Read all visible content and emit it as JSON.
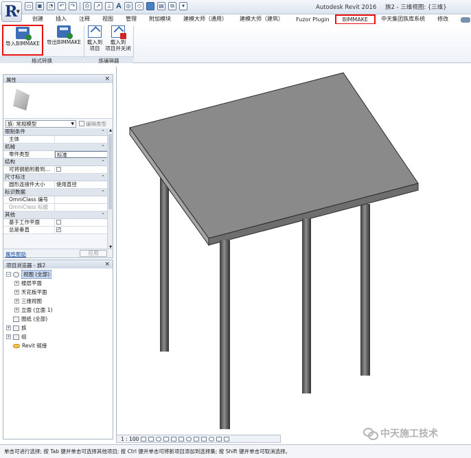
{
  "app": {
    "logo_letter": "R",
    "title": "Autodesk Revit 2016",
    "document": "族2 - 三维视图: {三维}"
  },
  "ribbon": {
    "tabs": [
      {
        "label": "创建"
      },
      {
        "label": "插入"
      },
      {
        "label": "注释"
      },
      {
        "label": "视图"
      },
      {
        "label": "管理"
      },
      {
        "label": "附加模块"
      },
      {
        "label": "建模大师（通用）"
      },
      {
        "label": "建模大师（建筑）"
      },
      {
        "label": "Fuzor Plugin"
      },
      {
        "label": "BIMMAKE"
      },
      {
        "label": "中天集团族库系统"
      },
      {
        "label": "修改"
      }
    ],
    "active_tab": "BIMMAKE",
    "buttons": {
      "import": "导入BIMMAKE",
      "export": "导出BIMMAKE",
      "load_to_project": "载入到\n项目",
      "load_close": "载入到\n项目并关闭"
    },
    "panels": {
      "format": "格式转换",
      "family_editor": "族编辑器"
    }
  },
  "properties": {
    "title": "属性",
    "type_name": "族: 常规模型",
    "edit_type": "编辑类型",
    "groups": [
      {
        "name": "限制条件",
        "rows": [
          {
            "k": "主体",
            "v": ""
          }
        ]
      },
      {
        "name": "机械",
        "rows": [
          {
            "k": "零件类型",
            "v": "标准"
          }
        ]
      },
      {
        "name": "结构",
        "rows": [
          {
            "k": "可将钢筋附着到...",
            "v": "",
            "check": false
          }
        ]
      },
      {
        "name": "尺寸标注",
        "rows": [
          {
            "k": "圆形连接件大小",
            "v": "使用直径"
          }
        ]
      },
      {
        "name": "标识数据",
        "rows": [
          {
            "k": "OmniClass 编号",
            "v": ""
          },
          {
            "k": "OmniClass 标题",
            "v": "",
            "dim": true
          }
        ]
      },
      {
        "name": "其他",
        "rows": [
          {
            "k": "基于工作平面",
            "v": "",
            "check": false
          },
          {
            "k": "总是垂直",
            "v": "",
            "check": true
          }
        ]
      }
    ],
    "help": "属性帮助",
    "apply": "应用"
  },
  "browser": {
    "title": "项目浏览器 - 族2",
    "items": [
      {
        "label": "视图 (全部)",
        "level": 0,
        "toggle": "-",
        "icon": "view"
      },
      {
        "label": "楼层平面",
        "level": 1,
        "toggle": "+"
      },
      {
        "label": "天花板平面",
        "level": 1,
        "toggle": "+"
      },
      {
        "label": "三维视图",
        "level": 1,
        "toggle": "+"
      },
      {
        "label": "立面 (立面 1)",
        "level": 1,
        "toggle": "+"
      },
      {
        "label": "图纸 (全部)",
        "level": 0,
        "toggle": "",
        "icon": "sheet"
      },
      {
        "label": "族",
        "level": 0,
        "toggle": "+",
        "icon": "family"
      },
      {
        "label": "组",
        "level": 0,
        "toggle": "+",
        "icon": "group"
      },
      {
        "label": "Revit 链接",
        "level": 0,
        "toggle": "",
        "icon": "link"
      }
    ]
  },
  "viewbar": {
    "scale": "1 : 100"
  },
  "watermark": "中天施工技术",
  "statusbar": {
    "text": "单击可进行选择; 按 Tab 键并单击可选择其他项目; 按 Ctrl 键并单击可将新项目添加到选择集; 按 Shift 键并单击可取消选择。"
  },
  "colors": {
    "highlight_red": "#e81010",
    "ribbon_bg": "#eef2f7",
    "table_top": "#8a8a8a",
    "leg": "#5a5a5a"
  }
}
